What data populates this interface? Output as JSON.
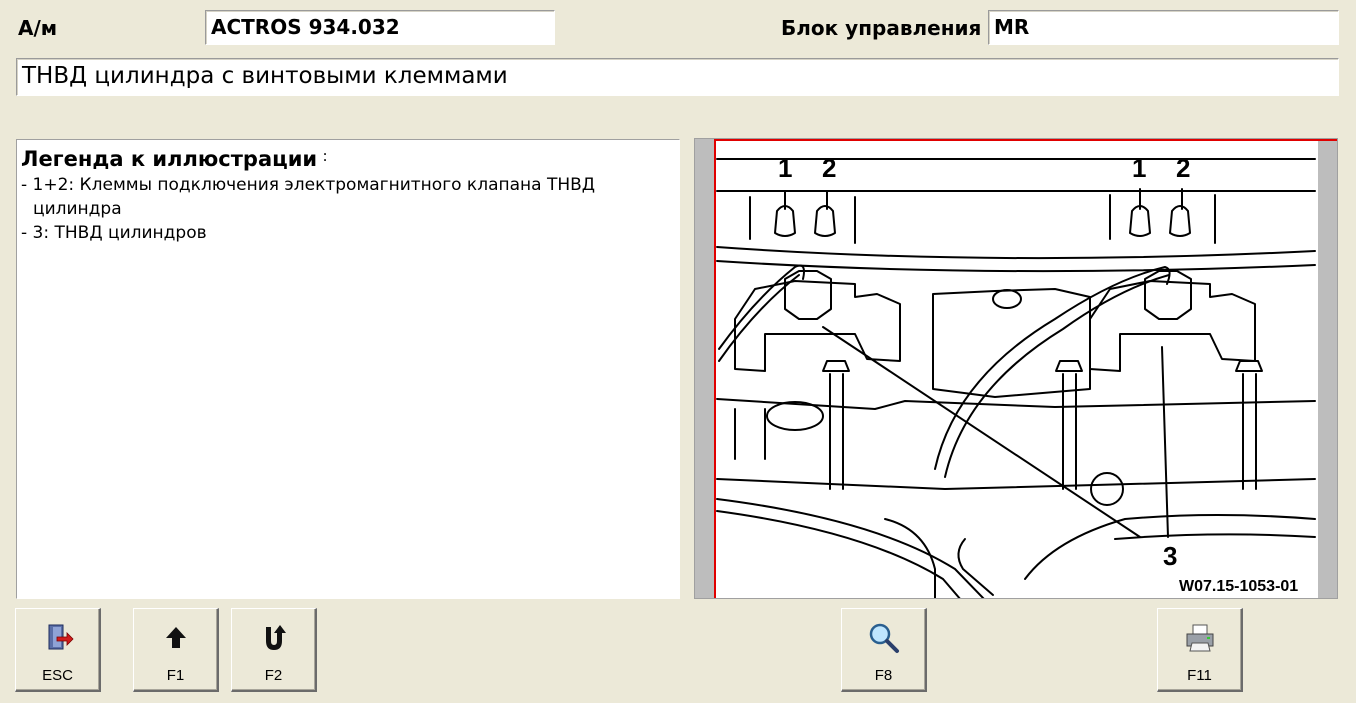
{
  "header": {
    "vehicle_label": "А/м",
    "vehicle_value": "ACTROS 934.032",
    "ecu_label": "Блок управления",
    "ecu_value": "MR",
    "title": "ТНВД цилиндра с винтовыми клеммами"
  },
  "legend": {
    "heading": "Легенда к иллюстрации",
    "heading_suffix": ":",
    "items": [
      "- 1+2: Клеммы подключения электромагнитного клапана ТНВД цилиндра",
      "- 3: ТНВД цилиндров"
    ]
  },
  "illustration": {
    "callouts": {
      "left_1": "1",
      "left_2": "2",
      "right_1": "1",
      "right_2": "2",
      "pump": "3"
    },
    "figure_id": "W07.15-1053-01",
    "accent_color": "#E00000"
  },
  "buttons": {
    "esc": {
      "label": "ESC",
      "icon": "exit-door-icon"
    },
    "f1": {
      "label": "F1",
      "icon": "arrow-up-icon"
    },
    "f2": {
      "label": "F2",
      "icon": "u-turn-icon"
    },
    "f8": {
      "label": "F8",
      "icon": "magnifier-icon"
    },
    "f11": {
      "label": "F11",
      "icon": "printer-icon"
    }
  }
}
